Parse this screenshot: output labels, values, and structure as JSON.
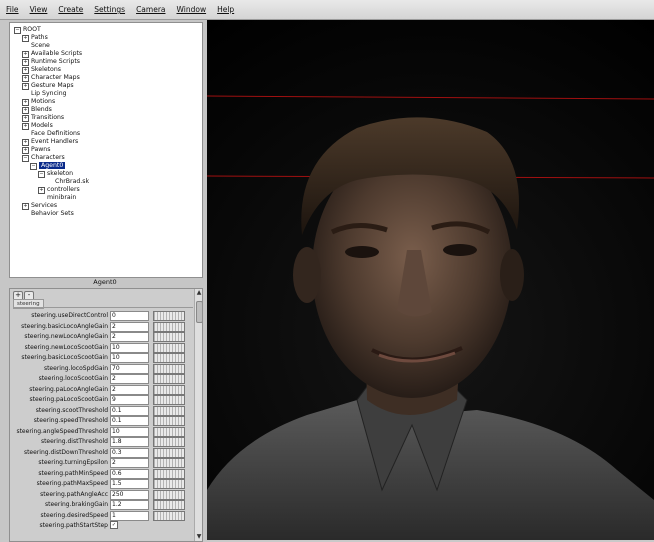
{
  "menu": [
    "File",
    "View",
    "Create",
    "Settings",
    "Camera",
    "Window",
    "Help"
  ],
  "tree": [
    {
      "label": "ROOT",
      "depth": 0,
      "exp": "−"
    },
    {
      "label": "Paths",
      "depth": 1,
      "exp": "+"
    },
    {
      "label": "Scene",
      "depth": 1,
      "exp": ""
    },
    {
      "label": "Available Scripts",
      "depth": 1,
      "exp": "+"
    },
    {
      "label": "Runtime Scripts",
      "depth": 1,
      "exp": "+"
    },
    {
      "label": "Skeletons",
      "depth": 1,
      "exp": "+"
    },
    {
      "label": "Character Maps",
      "depth": 1,
      "exp": "+"
    },
    {
      "label": "Gesture Maps",
      "depth": 1,
      "exp": "+"
    },
    {
      "label": "Lip Syncing",
      "depth": 1,
      "exp": ""
    },
    {
      "label": "Motions",
      "depth": 1,
      "exp": "+"
    },
    {
      "label": "Blends",
      "depth": 1,
      "exp": "+"
    },
    {
      "label": "Transitions",
      "depth": 1,
      "exp": "+"
    },
    {
      "label": "Models",
      "depth": 1,
      "exp": "+"
    },
    {
      "label": "Face Definitions",
      "depth": 1,
      "exp": ""
    },
    {
      "label": "Event Handlers",
      "depth": 1,
      "exp": "+"
    },
    {
      "label": "Pawns",
      "depth": 1,
      "exp": "+"
    },
    {
      "label": "Characters",
      "depth": 1,
      "exp": "−"
    },
    {
      "label": "Agent0",
      "depth": 2,
      "exp": "−",
      "selected": true
    },
    {
      "label": "skeleton",
      "depth": 3,
      "exp": "−"
    },
    {
      "label": "ChrBrad.sk",
      "depth": 4,
      "exp": ""
    },
    {
      "label": "controllers",
      "depth": 3,
      "exp": "+"
    },
    {
      "label": "minibrain",
      "depth": 3,
      "exp": ""
    },
    {
      "label": "Services",
      "depth": 1,
      "exp": "+"
    },
    {
      "label": "Behavior Sets",
      "depth": 1,
      "exp": ""
    }
  ],
  "properties_title": "Agent0",
  "add_label": "+",
  "remove_label": "-",
  "group_label": "steering",
  "properties": [
    {
      "name": "steering.useDirectControl",
      "value": "0"
    },
    {
      "name": "steering.basicLocoAngleGain",
      "value": "2"
    },
    {
      "name": "steering.newLocoAngleGain",
      "value": "2"
    },
    {
      "name": "steering.newLocoScootGain",
      "value": "10"
    },
    {
      "name": "steering.basicLocoScootGain",
      "value": "10"
    },
    {
      "name": "steering.locoSpdGain",
      "value": "70"
    },
    {
      "name": "steering.locoScootGain",
      "value": "2"
    },
    {
      "name": "steering.paLocoAngleGain",
      "value": "2"
    },
    {
      "name": "steering.paLocoScootGain",
      "value": "9"
    },
    {
      "name": "steering.scootThreshold",
      "value": "0.1"
    },
    {
      "name": "steering.speedThreshold",
      "value": "0.1"
    },
    {
      "name": "steering.angleSpeedThreshold",
      "value": "10"
    },
    {
      "name": "steering.distThreshold",
      "value": "1.8"
    },
    {
      "name": "steering.distDownThreshold",
      "value": "0.3"
    },
    {
      "name": "steering.turningEpsilon",
      "value": "2"
    },
    {
      "name": "steering.pathMinSpeed",
      "value": "0.6"
    },
    {
      "name": "steering.pathMaxSpeed",
      "value": "1.5"
    },
    {
      "name": "steering.pathAngleAcc",
      "value": "250"
    },
    {
      "name": "steering.brakingGain",
      "value": "1.2"
    },
    {
      "name": "steering.desiredSpeed",
      "value": "1"
    },
    {
      "name": "steering.pathStartStep",
      "value": "✓",
      "checkbox": true
    }
  ],
  "scroll_up": "▲",
  "scroll_down": "▼",
  "colors": {
    "selection": "#0a2a8a",
    "guide_line": "#a01010",
    "viewport_bg": "#050505"
  }
}
